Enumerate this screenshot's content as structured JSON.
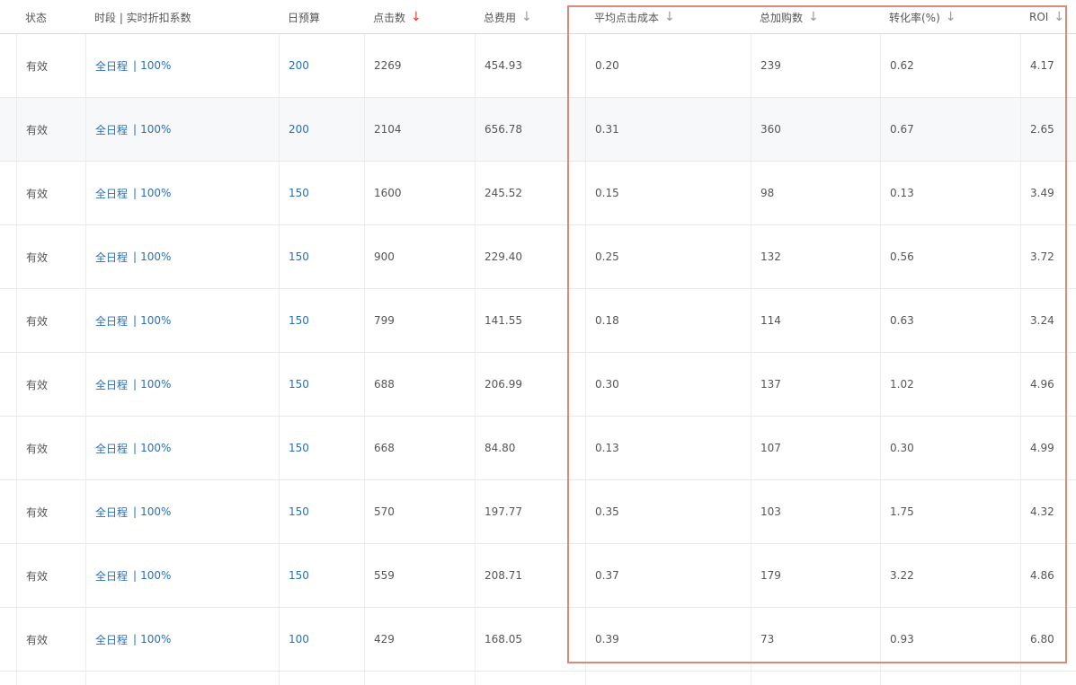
{
  "header": {
    "status": "状态",
    "period": "时段 | 实时折扣系数",
    "daily_budget": "日预算",
    "clicks": "点击数",
    "total_cost": "总费用",
    "avg_cpc": "平均点击成本",
    "cart_adds": "总加购数",
    "conversion_rate": "转化率(%)",
    "roi": "ROI",
    "sort_icon": "arrow-down-icon",
    "active_sort_color": "#e23a2e"
  },
  "rows": [
    {
      "status": "有效",
      "period": "全日程",
      "discount": "100%",
      "budget": "200",
      "clicks": "2269",
      "cost": "454.93",
      "cpc": "0.20",
      "carts": "239",
      "cvr": "0.62",
      "roi": "4.17"
    },
    {
      "status": "有效",
      "period": "全日程",
      "discount": "100%",
      "budget": "200",
      "clicks": "2104",
      "cost": "656.78",
      "cpc": "0.31",
      "carts": "360",
      "cvr": "0.67",
      "roi": "2.65"
    },
    {
      "status": "有效",
      "period": "全日程",
      "discount": "100%",
      "budget": "150",
      "clicks": "1600",
      "cost": "245.52",
      "cpc": "0.15",
      "carts": "98",
      "cvr": "0.13",
      "roi": "3.49"
    },
    {
      "status": "有效",
      "period": "全日程",
      "discount": "100%",
      "budget": "150",
      "clicks": "900",
      "cost": "229.40",
      "cpc": "0.25",
      "carts": "132",
      "cvr": "0.56",
      "roi": "3.72"
    },
    {
      "status": "有效",
      "period": "全日程",
      "discount": "100%",
      "budget": "150",
      "clicks": "799",
      "cost": "141.55",
      "cpc": "0.18",
      "carts": "114",
      "cvr": "0.63",
      "roi": "3.24"
    },
    {
      "status": "有效",
      "period": "全日程",
      "discount": "100%",
      "budget": "150",
      "clicks": "688",
      "cost": "206.99",
      "cpc": "0.30",
      "carts": "137",
      "cvr": "1.02",
      "roi": "4.96"
    },
    {
      "status": "有效",
      "period": "全日程",
      "discount": "100%",
      "budget": "150",
      "clicks": "668",
      "cost": "84.80",
      "cpc": "0.13",
      "carts": "107",
      "cvr": "0.30",
      "roi": "4.99"
    },
    {
      "status": "有效",
      "period": "全日程",
      "discount": "100%",
      "budget": "150",
      "clicks": "570",
      "cost": "197.77",
      "cpc": "0.35",
      "carts": "103",
      "cvr": "1.75",
      "roi": "4.32"
    },
    {
      "status": "有效",
      "period": "全日程",
      "discount": "100%",
      "budget": "150",
      "clicks": "559",
      "cost": "208.71",
      "cpc": "0.37",
      "carts": "179",
      "cvr": "3.22",
      "roi": "4.86"
    },
    {
      "status": "有效",
      "period": "全日程",
      "discount": "100%",
      "budget": "100",
      "clicks": "429",
      "cost": "168.05",
      "cpc": "0.39",
      "carts": "73",
      "cvr": "0.93",
      "roi": "6.80"
    }
  ]
}
